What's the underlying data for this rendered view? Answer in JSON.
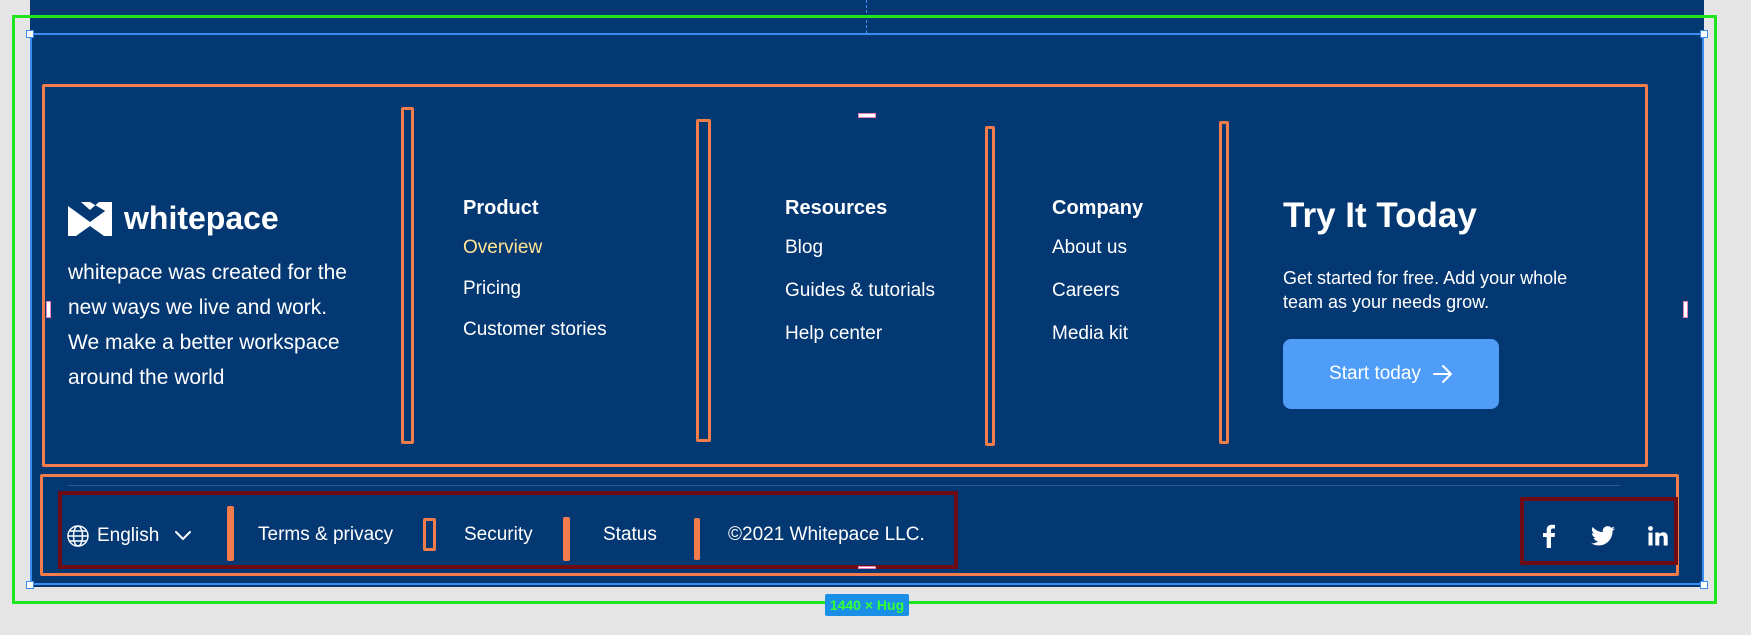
{
  "brand": {
    "name": "whitepace",
    "tagline": "whitepace was created for the new ways we live and work. We make a better workspace around the world"
  },
  "columns": [
    {
      "title": "Product",
      "links": [
        "Overview",
        "Pricing",
        "Customer stories"
      ],
      "active_index": 0
    },
    {
      "title": "Resources",
      "links": [
        "Blog",
        "Guides & tutorials",
        "Help center"
      ]
    },
    {
      "title": "Company",
      "links": [
        "About us",
        "Careers",
        "Media kit"
      ]
    }
  ],
  "cta": {
    "title": "Try It Today",
    "text": "Get started for free. Add your whole team as your needs grow.",
    "button_label": "Start today"
  },
  "bottom": {
    "language": "English",
    "links": [
      "Terms & privacy",
      "Security",
      "Status"
    ],
    "copyright": "©2021 Whitepace LLC."
  },
  "social": [
    "facebook-icon",
    "twitter-icon",
    "linkedin-icon"
  ],
  "editor": {
    "size_label": "1440 × Hug"
  },
  "colors": {
    "background": "#043873",
    "accent_link": "#FFE492",
    "button": "#4F9CF9",
    "selection_green": "#1FE51F",
    "selection_blue": "#3A8DF0",
    "frame_outline": "#F27C4B",
    "group_outline": "#6E0B14"
  }
}
